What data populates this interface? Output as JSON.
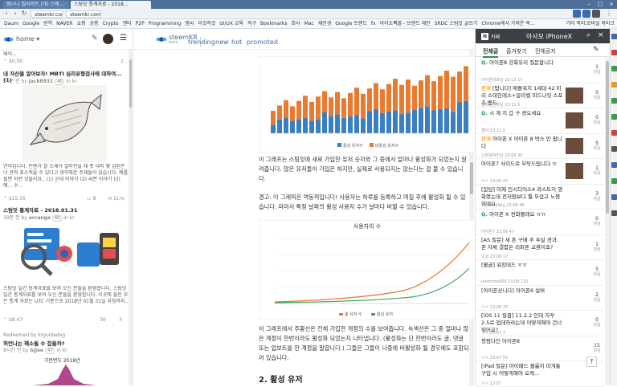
{
  "browser": {
    "tabs": [
      {
        "label": "썸나나 칠라이트 (개) 스웨..."
      },
      {
        "label": "스팀잇 통계자료 - 2018..."
      }
    ],
    "url_left": "steemkr.com",
    "url_right": "steemkr.com",
    "bookmarks": [
      "Daum",
      "Google",
      "번역",
      "NAVER",
      "쇼핑",
      "공용",
      "Crypto",
      "엔터",
      "P2P",
      "Programming",
      "엠씨",
      "이것저것",
      "UI/UX 교육",
      "직구",
      "Bookmarks",
      "회사",
      "Mac",
      "재인생",
      "Google 트렌드",
      "fx",
      "아이소팩볼 - 브랜드 재인",
      "SRDC 스팀잇 글쓰기",
      "Chrome에서 가져온 북..."
    ],
    "bookmarks_right": "기타 북마크",
    "bookmarks_right2": "모바일 북마크"
  },
  "left": {
    "home_label": "home",
    "top_snippet": "돼어...",
    "top_value": "$0.00",
    "top_votes": "1",
    "post1": {
      "title": "내 자산을 알아보자! MBTI 심리유형검사에 대하여...(1)",
      "meta_time": "24분 전 by",
      "author": "jack8831",
      "rep": "45",
      "community": "in kr",
      "excerpt": "연어입니다. 인텐가 잘 소재가 얼마전을 때 못 내지 몇 심된은 너 관적 표소적을 수 있다고 생각해본 주제들이 있습니다. 예를 들면 이런 것들이요.. (1) 군대 이야기 (2) 씨몬 이야기 (3) 예... 수...",
      "value": "$15.05",
      "comments": "8",
      "resteems": "11/∞"
    },
    "post2": {
      "title": "스팀잇 통계자료 - 2018.01.31",
      "meta_time": "39분 전 by",
      "author": "arcange",
      "rep": "66",
      "community": "in kr",
      "excerpt": "스팀잇 일간 통계자료를 보여 오신 분들을 환영합니다. 스팀잇 일간 통계자료를 보여 오신 분들을 환영합니다. 이곳에 올린 모든 통계 자료는 UTC 기준으로 2018년 01월 31일 자정까지...",
      "value": "$8.47",
      "votes": "36",
      "comments": "3"
    },
    "post3": {
      "resteem_label": "Redeemed by krguidedog",
      "title": "허언나는 헤소될 수 잡을까?",
      "meta_time": "8시간 전 by",
      "author": "bjjoe",
      "rep": "47",
      "community": "in kr",
      "chart_caption": "가문변도 2018년"
    }
  },
  "center": {
    "brand": "steemKR",
    "brand_sub": "beta",
    "categories": [
      "trending",
      "new",
      "hot",
      "promoted"
    ],
    "chart1_legend": [
      "활성 유저수",
      "비활성 유저수"
    ],
    "para1": "이 그래프는 스팀잇에 새로 가입한 유저 숫자와 그 중에서 얼마나 활성화가 되었는지 알려줍니다. 많은 유저들이 가입은 하지만, 실제로 사용되지는 않는다는 걸 볼 수 있습니다.",
    "para2": "경고: 이 그래픽은 역동적입니다! 사용자는 하루를 등록하고 며칠 후에 활성화 될 수 있습니다. 따라서 특정 날짜의 활성 사용자 수가 날마다 바뀔 수 있습니다.",
    "chart2_title": "사용자의 수",
    "chart2_legend": [
      "총 유저 수",
      "활성 유저"
    ],
    "para3": "이 그래프에서 주황선은 전체 가입한 계정의 수를 보여줍니다. 녹색선은 그 중 얼마나 많은 계정이 한번이라도 활성화 되었는지 나타냅니다. (활성화는 단 한번이라도 글, 댓글 또는 업보트를 한 계정을 말합니다.) 그들은 그들이 나중에 비활성화 될 경우에도 포함되어 있습니다.",
    "section2": "2. 활성 유저"
  },
  "cafe": {
    "word": "카페",
    "name": "아사모 iPhoneX",
    "tabs": [
      "전체글",
      "즐겨찾기",
      "전체공지"
    ],
    "posts": [
      {
        "prefix": "Q.",
        "title": "아이폰8 강화유리 질문합니다",
        "info": "아이폰바보님  22:13  17",
        "count": "1",
        "sub": "댓글",
        "thumb": false
      },
      {
        "prefix": "판매",
        "title": "[탑니다] 애플워치 1세대 42 미리 스테인레스+알리벨 미드나잇 스포츠 밴드",
        "info": "일하는진짜님  23:11  5",
        "count": "0",
        "sub": "댓글",
        "thumb": true
      },
      {
        "prefix": "Q.",
        "title": "시 계 지 갑 구 경오세요",
        "info": "별이  23:11  1",
        "count": "0",
        "sub": "댓글",
        "thumb": true
      },
      {
        "prefix": "판매",
        "title": "아이폰 X 아이폰 8 박스 만 팝니다",
        "info": "스마일박진님  23:09  35",
        "count": "5",
        "sub": "댓글",
        "thumb": true
      },
      {
        "prefix": "",
        "title": "아이폰7 사이드로 부탁드립니다 ㅠ",
        "info": "ㅇㅇ  23:09  47",
        "count": "1",
        "sub": "댓글",
        "thumb": true
      },
      {
        "prefix": "",
        "title": "[잡담] 어제 인시디어스4 라스트키 영화봤는데 전처럼보다 훨 무섭고 노잼이네요",
        "info": "1800mk9kg  23:08  46",
        "count": "3",
        "sub": "댓글",
        "thumb": false
      },
      {
        "prefix": "Q.",
        "title": "아이폰 X 전화플래요 ㅠㅠ",
        "info": "아이폰7  23:08  47",
        "count": "0",
        "sub": "댓글",
        "thumb": false
      },
      {
        "prefix": "",
        "title": "[AS 질문] 새 폰 구매 후 두달 경과. 폰 자체 결함은 리퍼폰 교환이죠?",
        "info": "오성  23:08  17",
        "count": "1",
        "sub": "댓글",
        "thumb": false
      },
      {
        "prefix": "",
        "title": "[불글] 워킹데드 ㅠㅠ",
        "info": "janmimo009  23:08  110",
        "count": "5",
        "sub": "댓글",
        "thumb": false
      },
      {
        "prefix": "",
        "title": "[아이폰상니다] 아이폰6 실버",
        "info": "ㅇㅇ  23:08  25",
        "count": "2",
        "sub": "댓글",
        "thumb": false
      },
      {
        "prefix": "",
        "title": "[iOS 11 릴꿈] 11.2.2 인데 자꾸 2.5로 업데하라는데 어떻게해야 건너뛰어요?",
        "info": "ㅇㅇ  23:07  7",
        "count": "0",
        "sub": "댓글",
        "thumb": false
      },
      {
        "prefix": "",
        "title": "청렴다인 아이폰8",
        "info": "ㅇㅇ  23:07  55",
        "count": "15",
        "sub": "댓글",
        "thumb": false
      },
      {
        "prefix": "",
        "title": "[iPad 질문] 아이패드 볼륨이 미개통 구입 시 어떻게해야 오케...",
        "info": "ㅇㅇ  23:07",
        "count": "",
        "sub": "",
        "thumb": false
      }
    ]
  }
}
